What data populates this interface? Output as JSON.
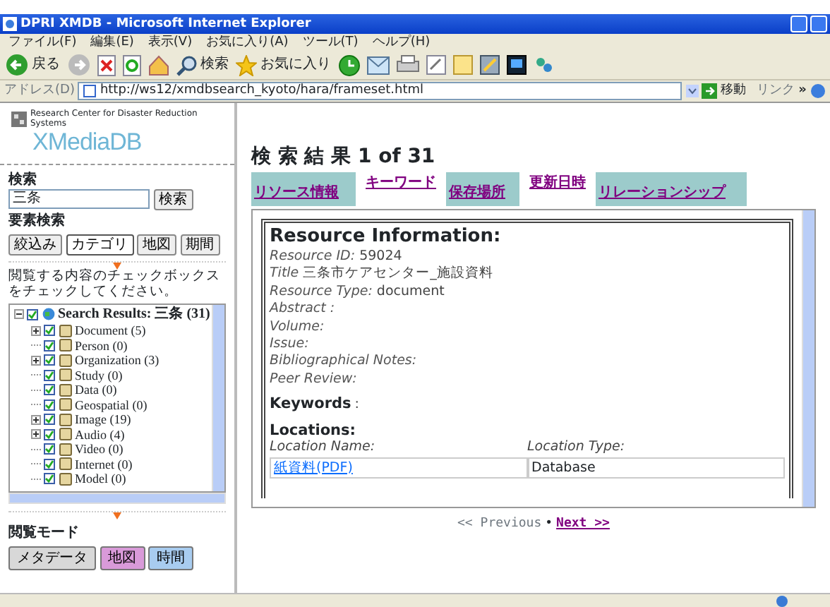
{
  "window": {
    "title": "DPRI XMDB - Microsoft Internet Explorer"
  },
  "menu": [
    "ファイル(F)",
    "編集(E)",
    "表示(V)",
    "お気に入り(A)",
    "ツール(T)",
    "ヘルプ(H)"
  ],
  "toolbar": {
    "back": "戻る",
    "search": "検索",
    "favorites": "お気に入り"
  },
  "address_bar": {
    "label": "アドレス(D)",
    "url": "http://ws12/xmdbsearch_kyoto/hara/frameset.html",
    "go": "移動",
    "links": "リンク",
    "more": "»"
  },
  "sidebar": {
    "logo_caption": "Research Center for Disaster Reduction Systems",
    "logo": "XMediaDB",
    "search_label": "検索",
    "search_value": "三条",
    "search_button": "検索",
    "element_search_label": "要素検索",
    "element_buttons": [
      {
        "label": "絞込み",
        "selected": false
      },
      {
        "label": "カテゴリ",
        "selected": true
      },
      {
        "label": "地図",
        "selected": false
      },
      {
        "label": "期間",
        "selected": false
      }
    ],
    "instruction": "閲覧する内容のチェックボックスをチェックしてください。",
    "tree": {
      "label": "Search Results: 三条 (31)",
      "checked": true,
      "expanded": true,
      "children": [
        {
          "label": "Document (5)",
          "checked": true,
          "expandable": true
        },
        {
          "label": "Person (0)",
          "checked": true,
          "expandable": false
        },
        {
          "label": "Organization (3)",
          "checked": true,
          "expandable": true
        },
        {
          "label": "Study (0)",
          "checked": true,
          "expandable": false
        },
        {
          "label": "Data (0)",
          "checked": true,
          "expandable": false
        },
        {
          "label": "Geospatial (0)",
          "checked": true,
          "expandable": false
        },
        {
          "label": "Image (19)",
          "checked": true,
          "expandable": true
        },
        {
          "label": "Audio (4)",
          "checked": true,
          "expandable": true
        },
        {
          "label": "Video (0)",
          "checked": true,
          "expandable": false
        },
        {
          "label": "Internet (0)",
          "checked": true,
          "expandable": false
        },
        {
          "label": "Model (0)",
          "checked": true,
          "expandable": false
        }
      ]
    },
    "view_mode_label": "閲覧モード",
    "view_buttons": [
      {
        "label": "メタデータ",
        "color": "#d8d8d8"
      },
      {
        "label": "地図",
        "color": "#d99ad9"
      },
      {
        "label": "時間",
        "color": "#a8ccf0"
      }
    ]
  },
  "results": {
    "heading": "検 索 結 果 1 of 31",
    "tabs": [
      {
        "label": "リソース情報",
        "shaded": true
      },
      {
        "label": "キーワード",
        "shaded": false
      },
      {
        "label": "保存場所",
        "shaded": true
      },
      {
        "label": "更新日時",
        "shaded": false
      },
      {
        "label": "リレーションシップ",
        "shaded": true
      }
    ],
    "resource_heading": "Resource Information:",
    "fields": [
      {
        "label": "Resource ID:",
        "value": "59024"
      },
      {
        "label": "Title",
        "value": "三条市ケアセンター_施設資料"
      },
      {
        "label": "Resource Type:",
        "value": "document"
      },
      {
        "label": "Abstract :"
      },
      {
        "label": "Volume:"
      },
      {
        "label": "Issue:"
      },
      {
        "label": "Bibliographical Notes:"
      },
      {
        "label": "Peer Review:"
      }
    ],
    "keywords_heading": "Keywords",
    "keywords_colon": ":",
    "locations_heading": "Locations:",
    "locations": {
      "columns": [
        "Location Name:",
        "Location Type:"
      ],
      "rows": [
        [
          "紙資料(PDF)",
          "Database"
        ]
      ]
    },
    "pager": {
      "previous": "<< Previous",
      "separator": "•",
      "next": "Next >>"
    }
  }
}
